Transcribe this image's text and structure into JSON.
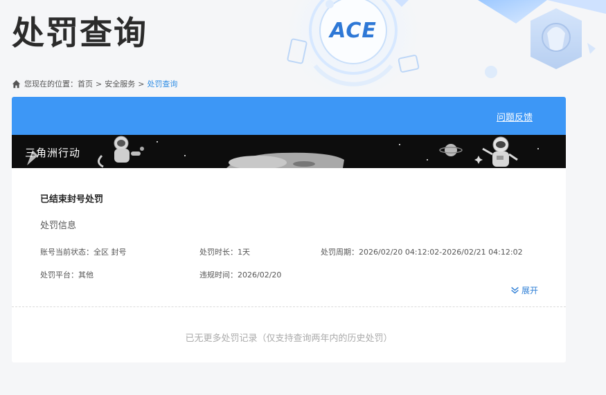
{
  "header": {
    "title": "处罚查询",
    "logo_text": "ACE"
  },
  "breadcrumb": {
    "prefix": "您现在的位置：",
    "items": [
      "首页",
      "安全服务",
      "处罚查询"
    ],
    "separator": ">"
  },
  "card": {
    "feedback_label": "问题反馈",
    "game_name": "三角洲行动"
  },
  "record": {
    "title": "已结束封号处罚",
    "info_title": "处罚信息",
    "fields": {
      "status": "账号当前状态：全区 封号",
      "duration": "处罚时长：1天",
      "period": "处罚周期：2026/02/20 04:12:02-2026/02/21 04:12:02",
      "platform": "处罚平台：其他",
      "violation_time": "违规时间：2026/02/20"
    },
    "expand_label": "展开"
  },
  "footer_note": "已无更多处罚记录（仅支持查询两年内的历史处罚）",
  "colors": {
    "accent": "#3d97f6",
    "link": "#2f7fd6",
    "breadcrumb_current": "#2f8de4",
    "banner_bg": "#0d0d0d"
  },
  "icons": {
    "breadcrumb": "home-icon",
    "expand": "double-chevron-down-icon"
  }
}
